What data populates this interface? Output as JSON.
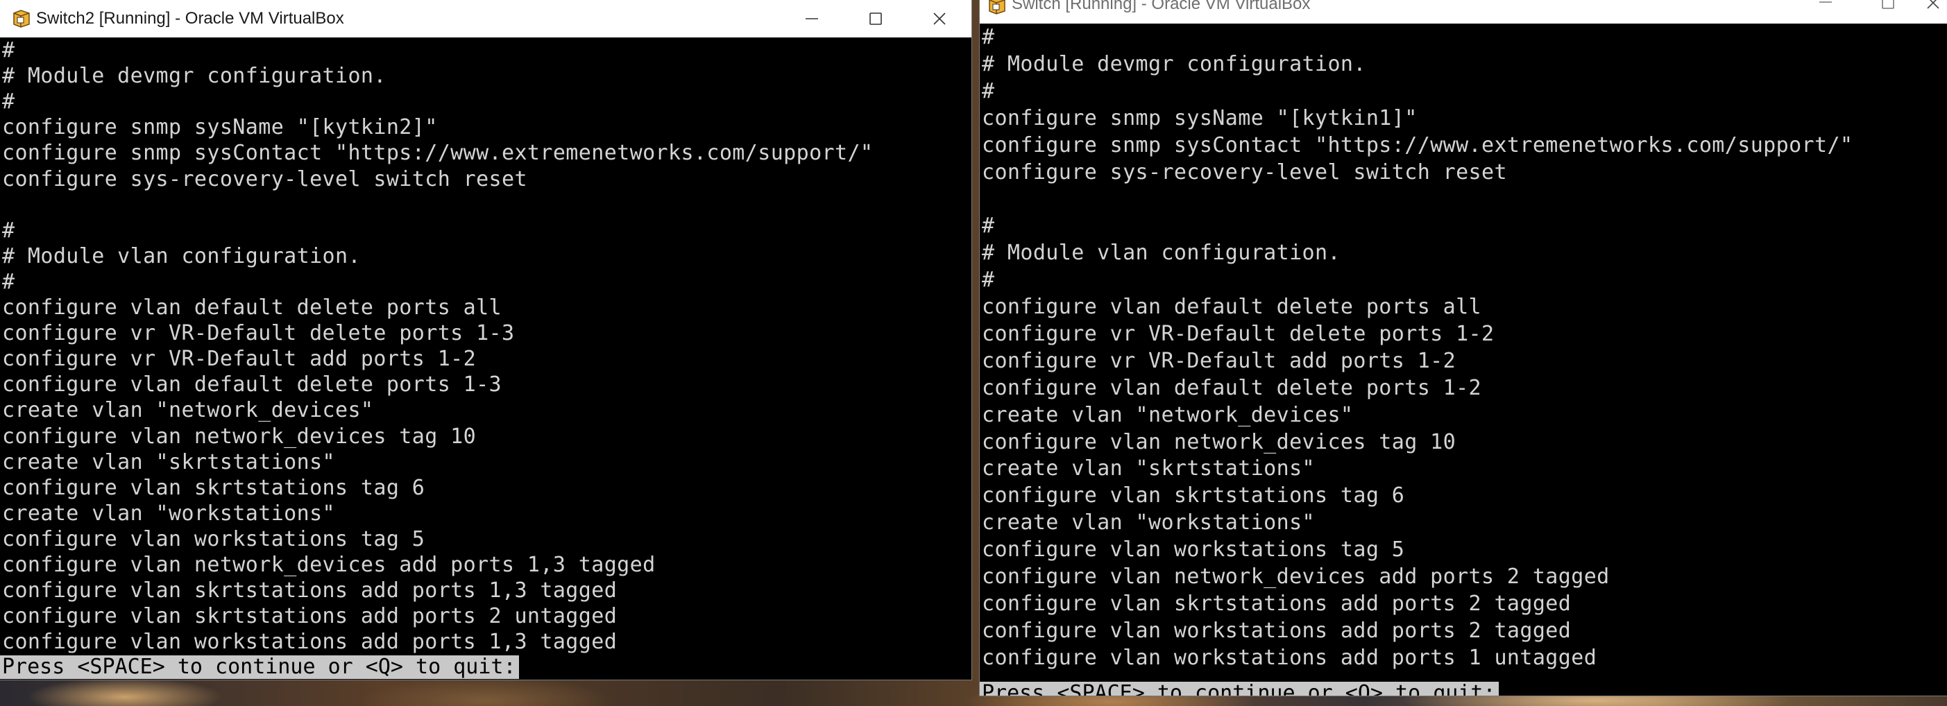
{
  "windows": [
    {
      "title": "Switch2 [Running] - Oracle VM VirtualBox",
      "lines": [
        "#",
        "# Module devmgr configuration.",
        "#",
        "configure snmp sysName \"[kytkin2]\"",
        "configure snmp sysContact \"https://www.extremenetworks.com/support/\"",
        "configure sys-recovery-level switch reset",
        "",
        "#",
        "# Module vlan configuration.",
        "#",
        "configure vlan default delete ports all",
        "configure vr VR-Default delete ports 1-3",
        "configure vr VR-Default add ports 1-2",
        "configure vlan default delete ports 1-3",
        "create vlan \"network_devices\"",
        "configure vlan network_devices tag 10",
        "create vlan \"skrtstations\"",
        "configure vlan skrtstations tag 6",
        "create vlan \"workstations\"",
        "configure vlan workstations tag 5",
        "configure vlan network_devices add ports 1,3 tagged",
        "configure vlan skrtstations add ports 1,3 tagged",
        "configure vlan skrtstations add ports 2 untagged",
        "configure vlan workstations add ports 1,3 tagged"
      ],
      "prompt": "Press <SPACE> to continue or <Q> to quit:"
    },
    {
      "title": "Switch [Running] - Oracle VM VirtualBox",
      "lines": [
        "#",
        "# Module devmgr configuration.",
        "#",
        "configure snmp sysName \"[kytkin1]\"",
        "configure snmp sysContact \"https://www.extremenetworks.com/support/\"",
        "configure sys-recovery-level switch reset",
        "",
        "#",
        "# Module vlan configuration.",
        "#",
        "configure vlan default delete ports all",
        "configure vr VR-Default delete ports 1-2",
        "configure vr VR-Default add ports 1-2",
        "configure vlan default delete ports 1-2",
        "create vlan \"network_devices\"",
        "configure vlan network_devices tag 10",
        "create vlan \"skrtstations\"",
        "configure vlan skrtstations tag 6",
        "create vlan \"workstations\"",
        "configure vlan workstations tag 5",
        "configure vlan network_devices add ports 2 tagged",
        "configure vlan skrtstations add ports 2 tagged",
        "configure vlan workstations add ports 2 tagged",
        "configure vlan workstations add ports 1 untagged"
      ],
      "prompt": "Press <SPACE> to continue or <Q> to quit:"
    }
  ],
  "icons": {
    "app": "virtualbox-icon",
    "minimize": "minimize-icon",
    "maximize": "maximize-icon",
    "close": "close-icon"
  },
  "colors": {
    "terminal_bg": "#000000",
    "terminal_fg": "#d4d4d4",
    "prompt_bg": "#c8c8c8",
    "titlebar_bg": "#ffffff"
  }
}
